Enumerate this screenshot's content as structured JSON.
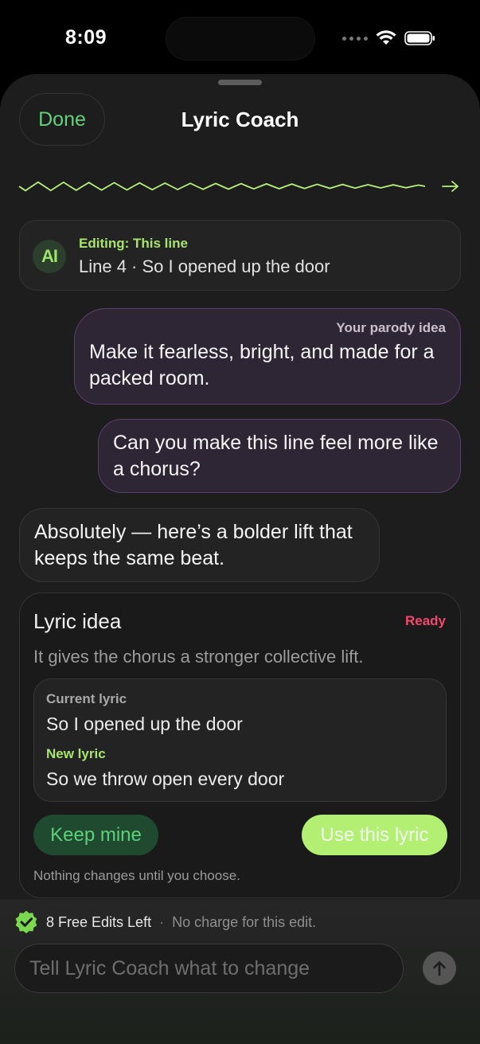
{
  "status_bar": {
    "time": "8:09"
  },
  "header": {
    "done_label": "Done",
    "title": "Lyric Coach"
  },
  "editing": {
    "label": "Editing: This line",
    "text": "Line 4 · So I opened up the door",
    "badge": "AI"
  },
  "messages": [
    {
      "role": "user",
      "label": "Your parody idea",
      "text": "Make it fearless, bright, and made for a packed room."
    },
    {
      "role": "user",
      "text": "Can you make this line feel more like a chorus?"
    },
    {
      "role": "assistant",
      "text": "Absolutely — here’s a bolder lift that keeps the same beat."
    }
  ],
  "lyric_idea": {
    "title": "Lyric idea",
    "status": "Ready",
    "description": "It gives the chorus a stronger collective lift.",
    "current_label": "Current lyric",
    "current_text": "So I opened up the door",
    "new_label": "New lyric",
    "new_text": "So we throw open every door",
    "keep_label": "Keep mine",
    "use_label": "Use this lyric",
    "note": "Nothing changes until you choose."
  },
  "footer": {
    "free_edits": "8 Free Edits Left",
    "separator": "·",
    "no_charge": "No charge for this edit.",
    "input_placeholder": "Tell Lyric Coach what to change"
  },
  "colors": {
    "accent_green": "#63d17b",
    "lime": "#b3ef73",
    "ready_red": "#f2476f",
    "user_bubble": "#2f2635"
  },
  "icons": [
    "signal-icon",
    "wifi-icon",
    "battery-icon",
    "wave-icon",
    "arrow-right-icon",
    "ai-text-icon",
    "verified-check-icon",
    "send-arrow-icon"
  ]
}
